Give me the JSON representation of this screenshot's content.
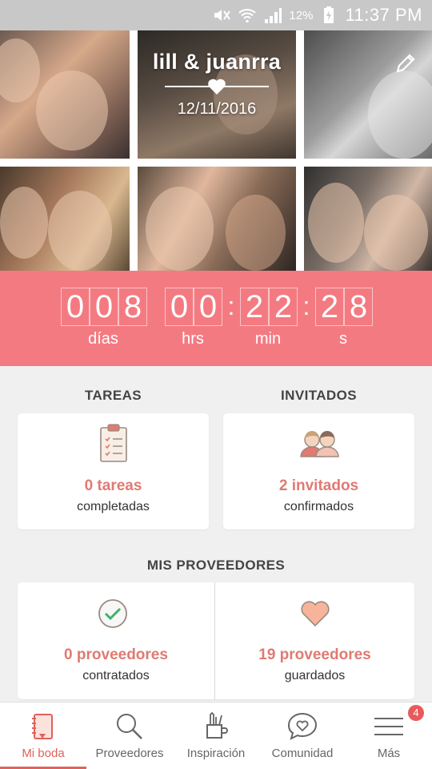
{
  "status_bar": {
    "battery_percent": "12%",
    "time": "11:37 PM",
    "icons": [
      "mute-icon",
      "wifi-icon",
      "signal-icon",
      "battery-charging-icon"
    ]
  },
  "header": {
    "couple_names": "lill & juanrra",
    "wedding_date": "12/11/2016",
    "photos": [
      "couple-photo",
      "couple-photo",
      "couple-photo",
      "couple-photo",
      "couple-photo",
      "couple-photo"
    ]
  },
  "countdown": {
    "days": [
      "0",
      "0",
      "8"
    ],
    "hours": [
      "0",
      "0"
    ],
    "minutes": [
      "2",
      "2"
    ],
    "seconds": [
      "2",
      "8"
    ],
    "separator": ":",
    "labels": {
      "days": "días",
      "hours": "hrs",
      "minutes": "min",
      "seconds": "s"
    }
  },
  "tasks": {
    "title": "TAREAS",
    "value": "0 tareas",
    "caption": "completadas",
    "icon": "clipboard-icon"
  },
  "guests": {
    "title": "INVITADOS",
    "value": "2 invitados",
    "caption": "confirmados",
    "icon": "guests-icon"
  },
  "vendors": {
    "title": "MIS PROVEEDORES",
    "hired": {
      "value": "0 proveedores",
      "caption": "contratados",
      "icon": "check-circle-icon"
    },
    "saved": {
      "value": "19 proveedores",
      "caption": "guardados",
      "icon": "heart-icon"
    }
  },
  "bottom_nav": {
    "items": [
      {
        "label": "Mi boda",
        "icon": "notebook-icon",
        "active": true
      },
      {
        "label": "Proveedores",
        "icon": "search-icon"
      },
      {
        "label": "Inspiración",
        "icon": "pencil-cup-icon"
      },
      {
        "label": "Comunidad",
        "icon": "chat-heart-icon"
      },
      {
        "label": "Más",
        "icon": "menu-icon",
        "badge": "4"
      }
    ]
  },
  "colors": {
    "accent": "#f47a82",
    "accent_text": "#e07a72",
    "active_nav": "#e0625a",
    "background": "#f0f0f0"
  }
}
